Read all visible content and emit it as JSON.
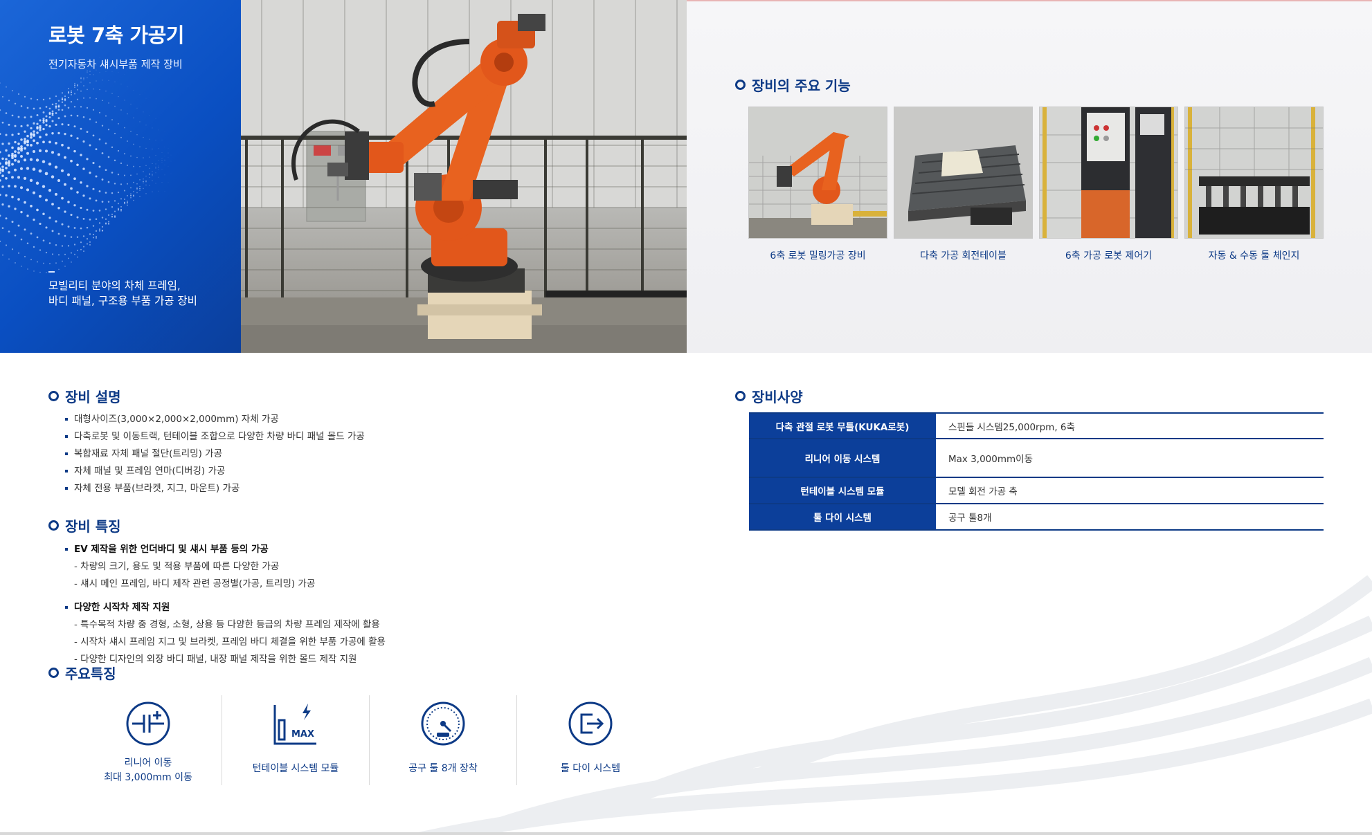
{
  "hero": {
    "title": "로봇 7축 가공기",
    "subtitle": "전기자동차 섀시부품 제작 장비",
    "description": "모빌리티 분야의 차체 프레임,\n바디 패널, 구조용 부품 가공 장비"
  },
  "functions": {
    "title": "장비의 주요 기능",
    "items": [
      {
        "caption": "6축 로봇 밀링가공 장비"
      },
      {
        "caption": "다축 가공 회전테이블"
      },
      {
        "caption": "6축 가공 로봇 제어기"
      },
      {
        "caption": "자동 & 수동 툴 체인지"
      }
    ]
  },
  "description": {
    "title": "장비 설명",
    "bullets": [
      "대형사이즈(3,000×2,000×2,000mm) 자체 가공",
      "다축로봇 및 이동트랙, 턴테이블 조합으로 다양한 차량 바디 패널 몰드 가공",
      "복합재료 자체 패널 절단(트리밍) 가공",
      "자체 패널 및 프레임 연마(디버깅) 가공",
      "자체 전용 부품(브라켓, 지그, 마운트) 가공"
    ]
  },
  "features": {
    "title": "장비 특징",
    "groups": [
      {
        "head": "EV 제작을 위한 언더바디 및 섀시 부품 등의 가공",
        "lines": [
          "- 차량의 크기, 용도 및 적용 부품에 따른 다양한 가공",
          "- 섀시 메인 프레임, 바디 제작 관련 공정별(가공, 트리밍) 가공"
        ]
      },
      {
        "head": "다양한 시작차 제작 지원",
        "lines": [
          "- 특수목적 차량 중 경형, 소형, 상용 등 다양한 등급의 차량 프레임 제작에 활용",
          "- 시작차 섀시 프레임 지그 및 브라켓, 프레임 바디 체결을 위한 부품 가공에 활용",
          "- 다양한 디자인의 외장 바디 패널, 내장 패널 제작을 위한 몰드 제작 지원"
        ]
      }
    ]
  },
  "specs": {
    "title": "장비사양",
    "rows": [
      {
        "key": "다축 관절 로봇 무틀(KUKA로봇)",
        "value": "스핀들 시스템25,000rpm, 6축"
      },
      {
        "key": "리니어 이동 시스템",
        "value": "Max 3,000mm이동"
      },
      {
        "key": "턴테이블 시스템 모듈",
        "value": "모델 회전 가공 축"
      },
      {
        "key": "툴 다이 시스템",
        "value": "공구 툴8개"
      }
    ]
  },
  "key_features": {
    "title": "주요특징",
    "items": [
      {
        "icon": "linear-move-icon",
        "label1": "리니어 이동",
        "label2": "최대 3,000mm 이동"
      },
      {
        "icon": "turntable-max-icon",
        "label1": "턴테이블 시스템 모듈",
        "label2": ""
      },
      {
        "icon": "gauge-icon",
        "label1": "공구 툴 8개 장착",
        "label2": ""
      },
      {
        "icon": "tool-exit-icon",
        "label1": "툴 다이 시스템",
        "label2": ""
      }
    ]
  },
  "colors": {
    "primary": "#0d3a86",
    "hero_blue": "#0a4fc2",
    "robot_orange": "#e2571b"
  }
}
